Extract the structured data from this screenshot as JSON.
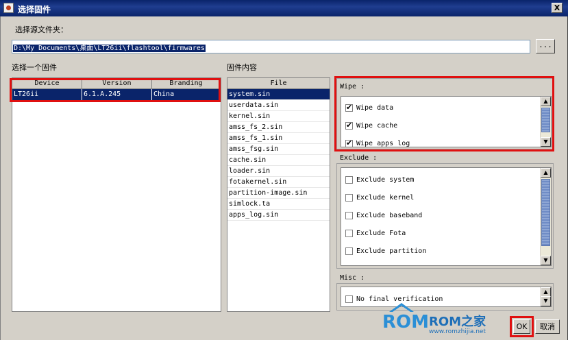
{
  "window": {
    "title": "选择固件",
    "close_glyph": "X"
  },
  "source_folder": {
    "label": "选择源文件夹：",
    "path": "D:\\My Documents\\桌面\\LT26ii\\flashtool\\firmwares",
    "browse_label": "..."
  },
  "firmware": {
    "label": "选择一个固件",
    "columns": [
      "Device",
      "Version",
      "Branding"
    ],
    "row": {
      "device": "LT26ii",
      "version": "6.1.A.245",
      "branding": "China"
    }
  },
  "content": {
    "label": "固件内容",
    "header": "File",
    "files": [
      "system.sin",
      "userdata.sin",
      "kernel.sin",
      "amss_fs_2.sin",
      "amss_fs_1.sin",
      "amss_fsg.sin",
      "cache.sin",
      "loader.sin",
      "fotakernel.sin",
      "partition-image.sin",
      "simlock.ta",
      "apps_log.sin"
    ]
  },
  "wipe": {
    "title": "Wipe :",
    "items": [
      {
        "label": "Wipe data",
        "checked": true
      },
      {
        "label": "Wipe cache",
        "checked": true
      },
      {
        "label": "Wipe apps_log",
        "checked": true
      }
    ]
  },
  "exclude": {
    "title": "Exclude :",
    "items": [
      {
        "label": "Exclude system",
        "checked": false
      },
      {
        "label": "Exclude kernel",
        "checked": false
      },
      {
        "label": "Exclude baseband",
        "checked": false
      },
      {
        "label": "Exclude Fota",
        "checked": false
      },
      {
        "label": "Exclude partition",
        "checked": false
      }
    ]
  },
  "misc": {
    "title": "Misc :",
    "items": [
      {
        "label": "No final verification",
        "checked": false
      }
    ]
  },
  "buttons": {
    "ok": "OK",
    "cancel": "取消"
  },
  "watermark": {
    "logo": "ROM",
    "brand": "ROM之家",
    "url": "www.romzhijia.net"
  },
  "colors": {
    "selection": "#0a246a",
    "highlight": "#e01010",
    "dialog_bg": "#d4d0c8"
  }
}
